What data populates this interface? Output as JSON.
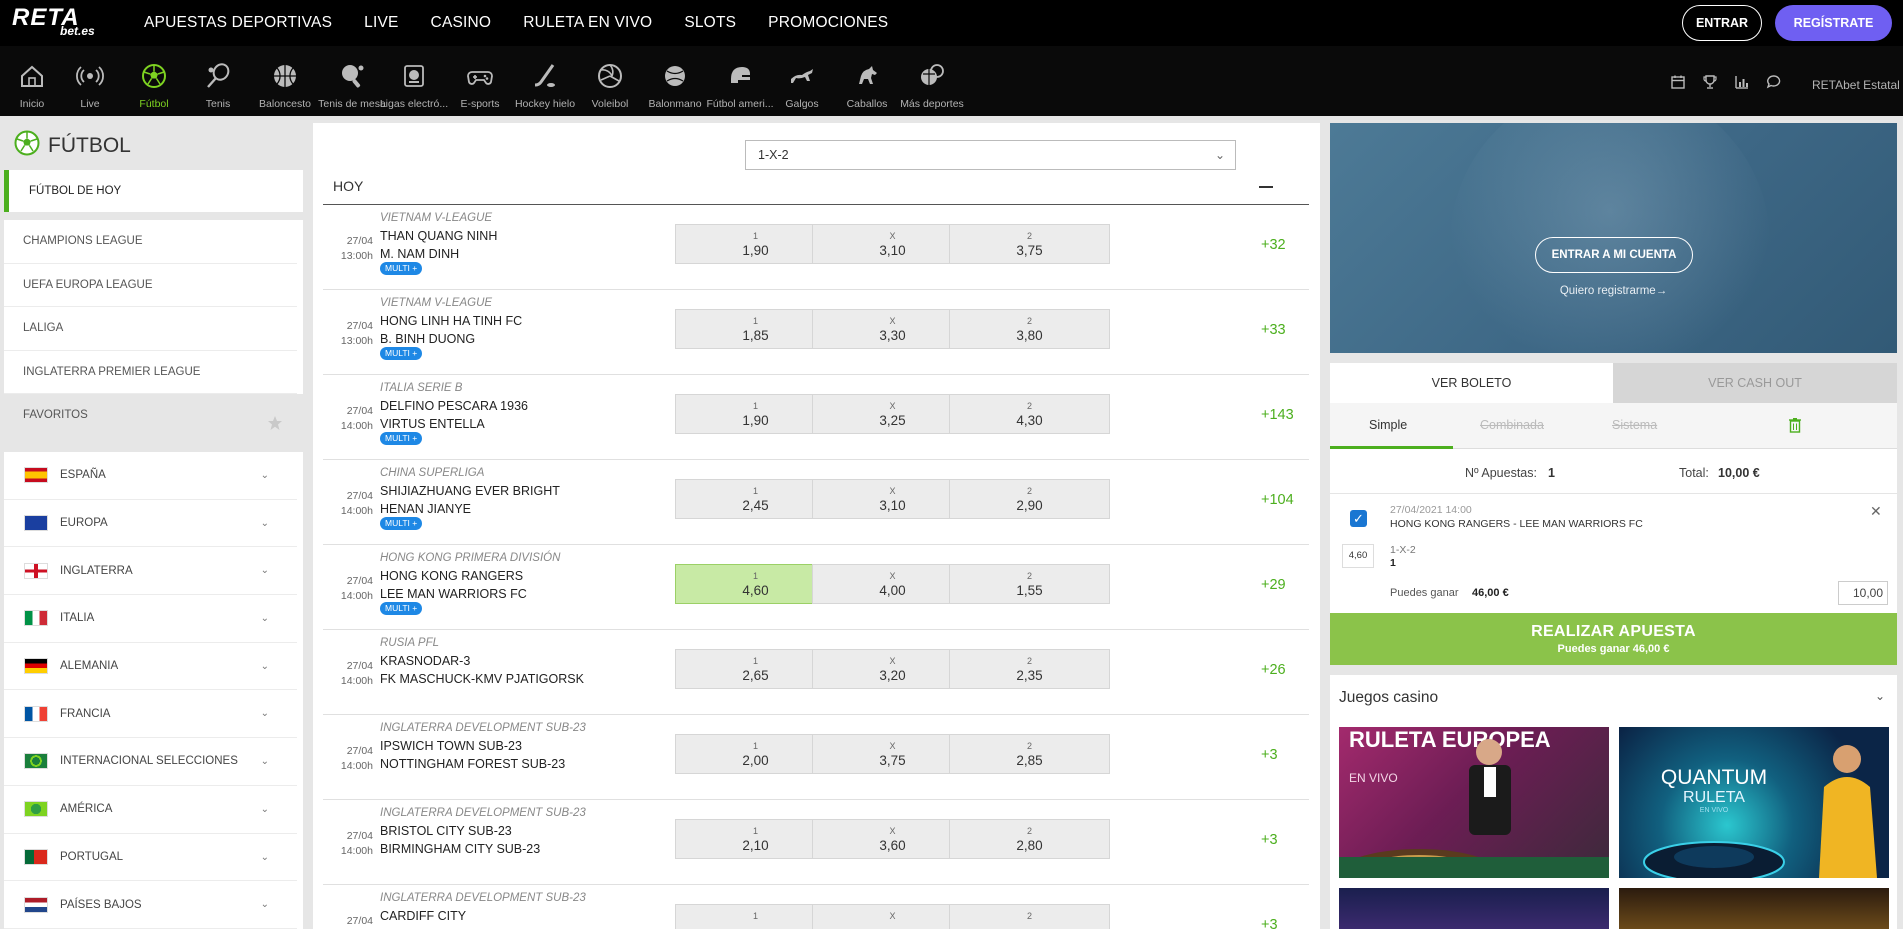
{
  "header": {
    "logo_main": "RETA",
    "logo_sub": "bet.es",
    "nav": [
      "APUESTAS DEPORTIVAS",
      "LIVE",
      "CASINO",
      "RULETA EN VIVO",
      "SLOTS",
      "PROMOCIONES"
    ],
    "login_label": "ENTRAR",
    "register_label": "REGÍSTRATE"
  },
  "sports": [
    {
      "label": "Inicio",
      "icon": "home-icon"
    },
    {
      "label": "Live",
      "icon": "live-broadcast-icon"
    },
    {
      "label": "Fútbol",
      "icon": "football-icon",
      "active": true
    },
    {
      "label": "Tenis",
      "icon": "tennis-icon"
    },
    {
      "label": "Baloncesto",
      "icon": "basketball-icon"
    },
    {
      "label": "Tenis de mesa",
      "icon": "table-tennis-icon"
    },
    {
      "label": "Ligas electró...",
      "icon": "esports-league-icon"
    },
    {
      "label": "E-sports",
      "icon": "gamepad-icon"
    },
    {
      "label": "Hockey hielo",
      "icon": "ice-hockey-icon"
    },
    {
      "label": "Voleibol",
      "icon": "volleyball-icon"
    },
    {
      "label": "Balonmano",
      "icon": "handball-icon"
    },
    {
      "label": "Fútbol ameri...",
      "icon": "american-football-icon"
    },
    {
      "label": "Galgos",
      "icon": "greyhound-icon"
    },
    {
      "label": "Caballos",
      "icon": "horse-icon"
    },
    {
      "label": "Más deportes",
      "icon": "more-sports-icon"
    }
  ],
  "utility": {
    "icons": [
      "calendar-icon",
      "trophy-icon",
      "stats-icon",
      "chat-icon"
    ],
    "estatal_text": "RETAbet Estatal"
  },
  "sidebar": {
    "title": "FÚTBOL",
    "today_item": "FÚTBOL DE HOY",
    "competitions": [
      "CHAMPIONS LEAGUE",
      "UEFA EUROPA LEAGUE",
      "LALIGA",
      "INGLATERRA PREMIER LEAGUE",
      "FAVORITOS"
    ],
    "countries": [
      {
        "name": "ESPAÑA",
        "flag": "es"
      },
      {
        "name": "EUROPA",
        "flag": "eu"
      },
      {
        "name": "INGLATERRA",
        "flag": "en"
      },
      {
        "name": "ITALIA",
        "flag": "it"
      },
      {
        "name": "ALEMANIA",
        "flag": "de"
      },
      {
        "name": "FRANCIA",
        "flag": "fr"
      },
      {
        "name": "INTERNACIONAL SELECCIONES",
        "flag": "int"
      },
      {
        "name": "AMÉRICA",
        "flag": "am"
      },
      {
        "name": "PORTUGAL",
        "flag": "pt"
      },
      {
        "name": "PAÍSES BAJOS",
        "flag": "nl"
      }
    ]
  },
  "events_panel": {
    "market_select": "1-X-2",
    "section_title": "HOY",
    "multi_badge": "MULTI +",
    "events": [
      {
        "league": "VIETNAM V-LEAGUE",
        "date": "27/04",
        "time": "13:00h",
        "home": "THAN QUANG NINH",
        "away": "M. NAM DINH",
        "multi": true,
        "odds": [
          {
            "label": "1",
            "value": "1,90"
          },
          {
            "label": "X",
            "value": "3,10"
          },
          {
            "label": "2",
            "value": "3,75"
          }
        ],
        "more": "+32"
      },
      {
        "league": "VIETNAM V-LEAGUE",
        "date": "27/04",
        "time": "13:00h",
        "home": "HONG LINH HA TINH FC",
        "away": "B. BINH DUONG",
        "multi": true,
        "odds": [
          {
            "label": "1",
            "value": "1,85"
          },
          {
            "label": "X",
            "value": "3,30"
          },
          {
            "label": "2",
            "value": "3,80"
          }
        ],
        "more": "+33"
      },
      {
        "league": "ITALIA SERIE B",
        "date": "27/04",
        "time": "14:00h",
        "home": "DELFINO PESCARA 1936",
        "away": "VIRTUS ENTELLA",
        "multi": true,
        "odds": [
          {
            "label": "1",
            "value": "1,90"
          },
          {
            "label": "X",
            "value": "3,25"
          },
          {
            "label": "2",
            "value": "4,30"
          }
        ],
        "more": "+143"
      },
      {
        "league": "CHINA SUPERLIGA",
        "date": "27/04",
        "time": "14:00h",
        "home": "SHIJIAZHUANG EVER BRIGHT",
        "away": "HENAN JIANYE",
        "multi": true,
        "odds": [
          {
            "label": "1",
            "value": "2,45"
          },
          {
            "label": "X",
            "value": "3,10"
          },
          {
            "label": "2",
            "value": "2,90"
          }
        ],
        "more": "+104"
      },
      {
        "league": "HONG KONG PRIMERA DIVISIÓN",
        "date": "27/04",
        "time": "14:00h",
        "home": "HONG KONG RANGERS",
        "away": "LEE MAN WARRIORS FC",
        "multi": true,
        "selected": 0,
        "odds": [
          {
            "label": "1",
            "value": "4,60"
          },
          {
            "label": "X",
            "value": "4,00"
          },
          {
            "label": "2",
            "value": "1,55"
          }
        ],
        "more": "+29"
      },
      {
        "league": "RUSIA PFL",
        "date": "27/04",
        "time": "14:00h",
        "home": "KRASNODAR-3",
        "away": "FK MASCHUCK-KMV PJATIGORSK",
        "multi": false,
        "odds": [
          {
            "label": "1",
            "value": "2,65"
          },
          {
            "label": "X",
            "value": "3,20"
          },
          {
            "label": "2",
            "value": "2,35"
          }
        ],
        "more": "+26"
      },
      {
        "league": "INGLATERRA DEVELOPMENT SUB-23",
        "date": "27/04",
        "time": "14:00h",
        "home": "IPSWICH TOWN SUB-23",
        "away": "NOTTINGHAM FOREST SUB-23",
        "multi": false,
        "odds": [
          {
            "label": "1",
            "value": "2,00"
          },
          {
            "label": "X",
            "value": "3,75"
          },
          {
            "label": "2",
            "value": "2,85"
          }
        ],
        "more": "+3"
      },
      {
        "league": "INGLATERRA DEVELOPMENT SUB-23",
        "date": "27/04",
        "time": "14:00h",
        "home": "BRISTOL CITY SUB-23",
        "away": "BIRMINGHAM CITY SUB-23",
        "multi": false,
        "odds": [
          {
            "label": "1",
            "value": "2,10"
          },
          {
            "label": "X",
            "value": "3,60"
          },
          {
            "label": "2",
            "value": "2,80"
          }
        ],
        "more": "+3"
      },
      {
        "league": "INGLATERRA DEVELOPMENT SUB-23",
        "date": "27/04",
        "time": "",
        "home": "CARDIFF CITY",
        "away": "",
        "multi": false,
        "odds": [
          {
            "label": "1",
            "value": ""
          },
          {
            "label": "X",
            "value": ""
          },
          {
            "label": "2",
            "value": ""
          }
        ],
        "more": "+3"
      }
    ]
  },
  "account_banner": {
    "login_button": "ENTRAR A MI CUENTA",
    "register_link": "Quiero registrarme"
  },
  "betslip": {
    "tab_ticket": "VER BOLETO",
    "tab_cashout": "VER CASH OUT",
    "subtab_simple": "Simple",
    "subtab_combined": "Combinada",
    "subtab_system": "Sistema",
    "bets_label": "Nº Apuestas:",
    "bets_value": "1",
    "total_label": "Total:",
    "total_value": "10,00 €",
    "selection": {
      "datetime": "27/04/2021 14:00",
      "match": "HONG KONG RANGERS - LEE MAN WARRIORS FC",
      "odd": "4,60",
      "market": "1-X-2",
      "pick": "1",
      "win_label": "Puedes ganar",
      "win_value": "46,00 €",
      "stake": "10,00"
    },
    "place_bet_label": "REALIZAR APUESTA",
    "place_bet_sub": "Puedes ganar 46,00 €"
  },
  "casino": {
    "title": "Juegos casino",
    "games": [
      {
        "title": "RULETA EUROPEA",
        "subtitle": "EN VIVO"
      },
      {
        "title": "QUANTUM",
        "subtitle": "RULETA",
        "tag": "EN VIVO"
      }
    ]
  },
  "colors": {
    "accent_green": "#7ed321",
    "register_purple": "#6f5ff2",
    "bet_button": "#8bc34a",
    "selected_odd": "#c8eaa5"
  }
}
